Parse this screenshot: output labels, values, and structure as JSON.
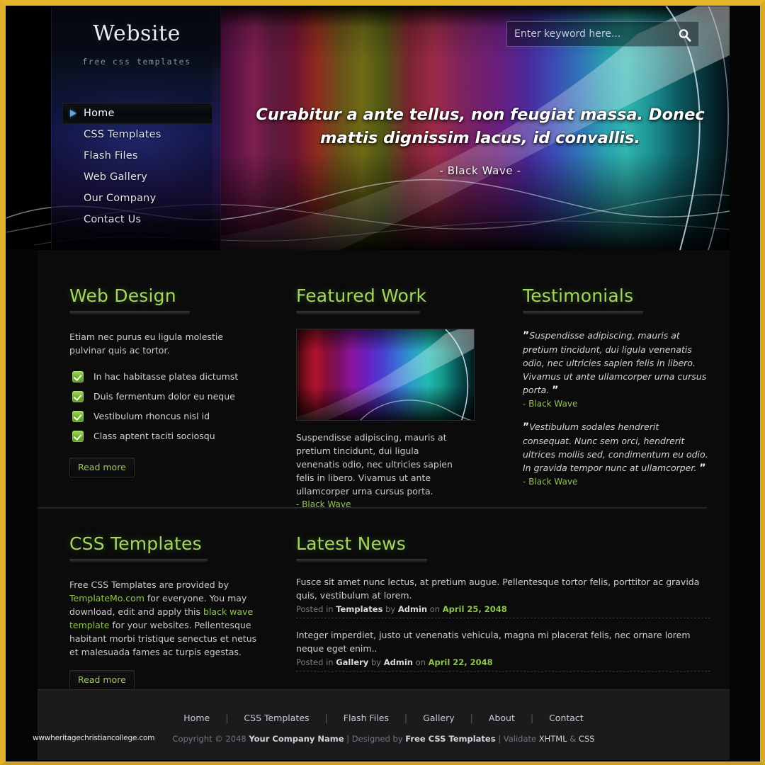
{
  "header": {
    "logo_title": "Website",
    "logo_tagline": "free css templates"
  },
  "search": {
    "placeholder": "Enter keyword here...",
    "value": "",
    "icon": "search-icon"
  },
  "nav": {
    "items": [
      {
        "label": "Home",
        "active": true
      },
      {
        "label": "CSS Templates",
        "active": false
      },
      {
        "label": "Flash Files",
        "active": false
      },
      {
        "label": "Web Gallery",
        "active": false
      },
      {
        "label": "Our Company",
        "active": false
      },
      {
        "label": "Contact Us",
        "active": false
      }
    ]
  },
  "hero": {
    "quote": "Curabitur a ante tellus, non feugiat massa. Donec mattis dignissim lacus, id convallis.",
    "author": "- Black Wave -"
  },
  "web_design": {
    "title": "Web Design",
    "intro": "Etiam nec purus eu ligula molestie pulvinar quis ac tortor.",
    "bullets": [
      "In hac habitasse platea dictumst",
      "Duis fermentum dolor eu neque",
      "Vestibulum rhoncus nisl id",
      "Class aptent taciti sociosqu"
    ],
    "read_more": "Read more"
  },
  "featured_work": {
    "title": "Featured Work",
    "image_alt": "black-wave-artwork",
    "text": "Suspendisse adipiscing, mauris at pretium tincidunt, dui ligula venenatis odio, nec ultricies sapien felis in libero. Vivamus ut ante ullamcorper urna cursus porta.",
    "author": "- Black Wave"
  },
  "testimonials": {
    "title": "Testimonials",
    "items": [
      {
        "text": "Suspendisse adipiscing, mauris at pretium tincidunt, dui ligula venenatis odio, nec ultricies sapien felis in libero. Vivamus ut ante ullamcorper urna cursus porta.",
        "author": "- Black Wave"
      },
      {
        "text": "Vestibulum sodales hendrerit consequat. Nunc sem orci, hendrerit ultrices mollis sed, condimentum eu odio. In gravida tempor nunc at ullamcorper.",
        "author": "- Black Wave"
      }
    ]
  },
  "css_templates": {
    "title": "CSS Templates",
    "part1": "Free CSS Templates are provided by ",
    "link1": "TemplateMo.com",
    "part2": " for everyone. You may download, edit and apply this ",
    "link2": "black wave template",
    "part3": " for your websites. Pellentesque habitant morbi tristique senectus et netus et malesuada fames ac turpis egestas.",
    "read_more": "Read more"
  },
  "latest_news": {
    "title": "Latest News",
    "items": [
      {
        "text": "Fusce sit amet nunc lectus, at pretium augue. Pellentesque tortor felis, porttitor ac gravida quis, vestibulum at lorem.",
        "posted_in_label": "Posted in",
        "category": "Templates",
        "by_label": "by",
        "author": "Admin",
        "on_label": "on",
        "date": "April 25, 2048"
      },
      {
        "text": "Integer imperdiet, justo ut venenatis vehicula, magna mi placerat felis, nec ornare lorem neque eget enim..",
        "posted_in_label": "Posted in",
        "category": "Gallery",
        "by_label": "by",
        "author": "Admin",
        "on_label": "on",
        "date": "April 22, 2048"
      }
    ]
  },
  "footer": {
    "nav": [
      "Home",
      "CSS Templates",
      "Flash Files",
      "Gallery",
      "About",
      "Contact"
    ],
    "separator": "|",
    "copyright_pre": "Copyright © 2048 ",
    "company": "Your Company Name",
    "designed_by_label": " | Designed by ",
    "designer": "Free CSS Templates",
    "validate_label": " | Validate ",
    "validate_xhtml": "XHTML",
    "validate_amp": " & ",
    "validate_css": "CSS",
    "watermark": "wwwheritagechristiancollege.com"
  },
  "colors": {
    "accent_green": "#8fc44e",
    "heading_green": "#a3d65f",
    "frame_gold": "#e5b52a",
    "nav_arrow_blue": "#5aa8e8"
  }
}
